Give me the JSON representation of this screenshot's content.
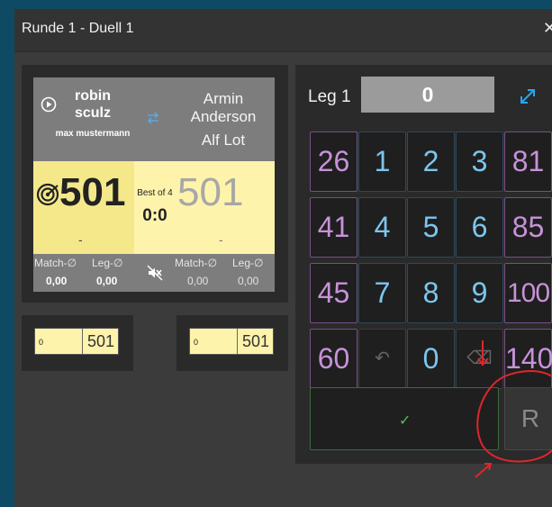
{
  "window": {
    "title": "Runde 1 - Duell 1",
    "close_glyph": "✕"
  },
  "player1": {
    "name": "robin sculz",
    "subname": "max mustermann",
    "score": "501",
    "dash": "-",
    "match_avg": "0,00",
    "leg_avg": "0,00"
  },
  "player2": {
    "name": "Armin Anderson",
    "subname": "Alf Lot",
    "score": "501",
    "dash": "-",
    "match_avg": "0,00",
    "leg_avg": "0,00"
  },
  "match": {
    "best_of": "Best of 4",
    "leg_score": "0:0"
  },
  "stats": {
    "match_avg_label": "Match-∅",
    "leg_avg_label": "Leg-∅"
  },
  "mini_boxes": [
    {
      "count": "0",
      "score": "501"
    },
    {
      "count": "0",
      "score": "501"
    }
  ],
  "keypad": {
    "leg_label": "Leg 1",
    "input_value": "0",
    "rows": [
      [
        "26",
        "1",
        "2",
        "3",
        "81"
      ],
      [
        "41",
        "4",
        "5",
        "6",
        "85"
      ],
      [
        "45",
        "7",
        "8",
        "9",
        "100"
      ],
      [
        "60",
        "↶",
        "0",
        "⌫",
        "140"
      ]
    ],
    "confirm_glyph": "✓",
    "r_label": "R"
  },
  "icons": [
    "play-circle-icon",
    "swap-icon",
    "target-icon",
    "mute-icon",
    "expand-icon",
    "undo-icon",
    "backspace-icon",
    "check-icon",
    "close-icon"
  ],
  "colors": {
    "accent_purple": "#c792d8",
    "accent_blue": "#7cc6ee",
    "active_yellow": "#f5e88a",
    "annotation_red": "#e0262b"
  }
}
